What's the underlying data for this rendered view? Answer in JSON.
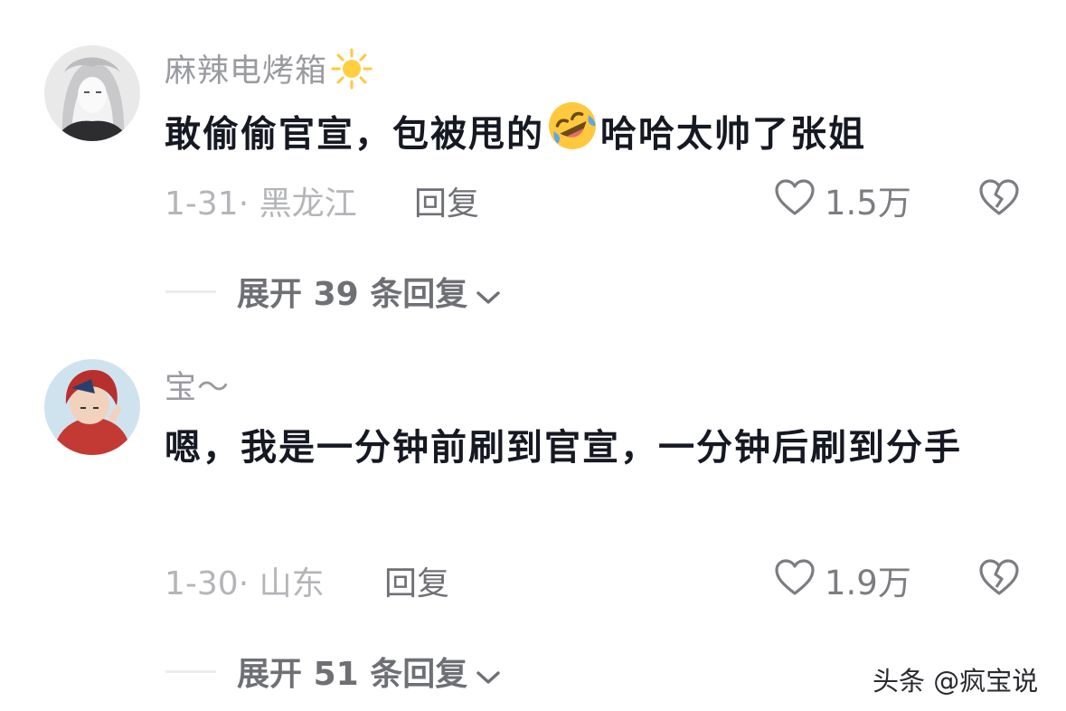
{
  "comments": [
    {
      "username": "麻辣电烤箱",
      "username_icon": "sun-icon",
      "text_before": "敢偷偷官宣，包被甩的",
      "emoji": "rolling-on-floor-laughing-emoji",
      "text_after": "哈哈太帅了张姐",
      "date_location": "1-31· 黑龙江",
      "reply_label": "回复",
      "likes": "1.5万",
      "expand_prefix": "展开",
      "expand_count": "39",
      "expand_suffix": "条回复"
    },
    {
      "username": "宝～",
      "text": "嗯，我是一分钟前刷到官宣，一分钟后刷到分手",
      "date_location": "1-30· 山东",
      "reply_label": "回复",
      "likes": "1.9万",
      "expand_prefix": "展开",
      "expand_count": "51",
      "expand_suffix": "条回复"
    }
  ],
  "watermark": "头条 @疯宝说",
  "colors": {
    "text_primary": "#161823",
    "username": "#9a9ba0",
    "meta": "#b4b5b9",
    "action": "#6f7075",
    "emoji_yellow": "#ffc83d"
  }
}
